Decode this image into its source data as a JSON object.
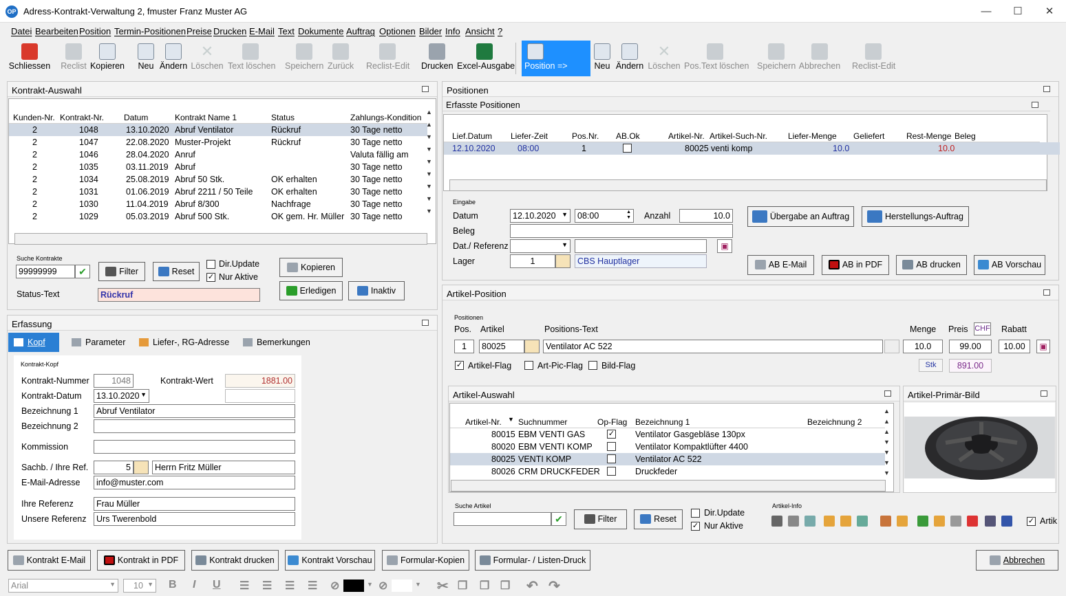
{
  "window": {
    "title": "Adress-Kontrakt-Verwaltung  2,  fmuster   Franz Muster AG",
    "min": "—",
    "max": "☐",
    "close": "✕"
  },
  "menu": [
    "Datei",
    "Bearbeiten",
    "Position",
    "Termin-Positionen",
    "Preise",
    "Drucken",
    "E-Mail",
    "Text",
    "Dokumente",
    "Auftrag",
    "Optionen",
    "Bilder",
    "Info",
    "Ansicht",
    "?"
  ],
  "toolbar_left": [
    "Schliessen",
    "Reclist",
    "Kopieren",
    "Neu",
    "Ändern",
    "Löschen",
    "Text löschen",
    "Speichern",
    "Zurück",
    "Reclist-Edit",
    "Drucken",
    "Excel-Ausgabe"
  ],
  "toolbar_right": [
    "Position =>",
    "Neu",
    "Ändern",
    "Löschen",
    "Pos.Text löschen",
    "Speichern",
    "Abbrechen",
    "Reclist-Edit"
  ],
  "kontrakt": {
    "title": "Kontrakt-Auswahl",
    "headers": [
      "Kunden-Nr.",
      "Kontrakt-Nr.",
      "Datum",
      "Kontrakt Name 1",
      "Status",
      "Zahlungs-Kondition"
    ],
    "rows": [
      [
        "2",
        "1048",
        "13.10.2020",
        "Abruf Ventilator",
        "Rückruf",
        "30 Tage netto"
      ],
      [
        "2",
        "1047",
        "22.08.2020",
        "Muster-Projekt",
        "Rückruf",
        "30 Tage netto"
      ],
      [
        "2",
        "1046",
        "28.04.2020",
        "Anruf",
        "",
        "Valuta fällig am"
      ],
      [
        "2",
        "1035",
        "03.11.2019",
        "Abruf",
        "",
        "30 Tage netto"
      ],
      [
        "2",
        "1034",
        "25.08.2019",
        "Abruf 50 Stk.",
        "OK erhalten",
        "30 Tage netto"
      ],
      [
        "2",
        "1031",
        "01.06.2019",
        "Abruf 2211 / 50 Teile",
        "OK erhalten",
        "30 Tage netto"
      ],
      [
        "2",
        "1030",
        "11.04.2019",
        "Abruf 8/300",
        "Nachfrage",
        "30 Tage netto"
      ],
      [
        "2",
        "1029",
        "05.03.2019",
        "Abruf 500 Stk.",
        "OK gem. Hr. Müller",
        "30 Tage netto"
      ]
    ],
    "search_label": "Suche Kontrakte",
    "search_value": "99999999",
    "filter": "Filter",
    "reset": "Reset",
    "dir_update": "Dir.Update",
    "nur_aktive": "Nur Aktive",
    "kopieren": "Kopieren",
    "erledigen": "Erledigen",
    "inaktiv": "Inaktiv",
    "status_label": "Status-Text",
    "status_value": "Rückruf"
  },
  "erfassung": {
    "title": "Erfassung",
    "tabs": [
      "Kopf",
      "Parameter",
      "Liefer-, RG-Adresse",
      "Bemerkungen"
    ],
    "group": "Kontrakt-Kopf",
    "nummer_l": "Kontrakt-Nummer",
    "nummer": "1048",
    "wert_l": "Kontrakt-Wert",
    "wert": "1881.00",
    "datum_l": "Kontrakt-Datum",
    "datum": "13.10.2020",
    "bez1_l": "Bezeichnung 1",
    "bez1": "Abruf Ventilator",
    "bez2_l": "Bezeichnung 2",
    "kommission_l": "Kommission",
    "sachb_l": "Sachb. / Ihre Ref.",
    "sachb_nr": "5",
    "sachb": "Herrn Fritz Müller",
    "email_l": "E-Mail-Adresse",
    "email": "info@muster.com",
    "ihre_l": "Ihre Referenz",
    "ihre": "Frau Müller",
    "unsere_l": "Unsere Referenz",
    "unsere": "Urs Twerenbold"
  },
  "positionen": {
    "title": "Positionen",
    "sub": "Erfasste Positionen",
    "headers": [
      "Lief.Datum",
      "Liefer-Zeit",
      "Pos.Nr.",
      "AB.Ok",
      "Artikel-Nr.",
      "Artikel-Such-Nr.",
      "Liefer-Menge",
      "Geliefert",
      "Rest-Menge",
      "Beleg"
    ],
    "row": [
      "12.10.2020",
      "08:00",
      "1",
      "",
      "80025",
      "venti komp",
      "10.0",
      "",
      "10.0",
      ""
    ],
    "eingabe": "Eingabe",
    "datum_l": "Datum",
    "datum": "12.10.2020",
    "zeit": "08:00",
    "anzahl_l": "Anzahl",
    "anzahl": "10.0",
    "beleg_l": "Beleg",
    "ref_l": "Dat./ Referenz",
    "lager_l": "Lager",
    "lager_nr": "1",
    "lager": "CBS Hauptlager",
    "uebergabe": "Übergabe an Auftrag",
    "herstellung": "Herstellungs-Auftrag",
    "ab_email": "AB E-Mail",
    "ab_pdf": "AB in PDF",
    "ab_drucken": "AB drucken",
    "ab_vorschau": "AB Vorschau"
  },
  "artpos": {
    "title": "Artikel-Position",
    "group": "Positionen",
    "pos_l": "Pos.",
    "artikel_l": "Artikel",
    "text_l": "Positions-Text",
    "menge_l": "Menge",
    "preis_l": "Preis",
    "chf": "CHF",
    "rabatt_l": "Rabatt",
    "pos": "1",
    "artikel": "80025",
    "text": "Ventilator AC 522",
    "menge": "10.0",
    "preis": "99.00",
    "rabatt": "10.00",
    "stk": "Stk",
    "total": "891.00",
    "artikel_flag": "Artikel-Flag",
    "artpic_flag": "Art-Pic-Flag",
    "bild_flag": "Bild-Flag"
  },
  "artauswahl": {
    "title": "Artikel-Auswahl",
    "headers": [
      "Artikel-Nr.",
      "Suchnummer",
      "Op-Flag",
      "Bezeichnung 1",
      "Bezeichnung 2"
    ],
    "rows": [
      [
        "80015",
        "EBM VENTI GAS",
        "✓",
        "Ventilator Gasgebläse 130px",
        ""
      ],
      [
        "80020",
        "EBM VENTI KOMP",
        "",
        "Ventilator Kompaktlüfter 4400",
        ""
      ],
      [
        "80025",
        "VENTI KOMP",
        "",
        "Ventilator AC 522",
        ""
      ],
      [
        "80026",
        "CRM DRUCKFEDER",
        "",
        "Druckfeder",
        ""
      ]
    ],
    "search_label": "Suche Artikel",
    "filter": "Filter",
    "reset": "Reset",
    "dir_update": "Dir.Update",
    "nur_aktive": "Nur Aktive",
    "info": "Artikel-Info",
    "artik": "Artik"
  },
  "bild": {
    "title": "Artikel-Primär-Bild"
  },
  "bottom": [
    "Kontrakt E-Mail",
    "Kontrakt in PDF",
    "Kontrakt drucken",
    "Kontrakt Vorschau",
    "Formular-Kopien",
    "Formular- / Listen-Druck"
  ],
  "abbrechen": "Abbrechen",
  "format": {
    "font": "Arial",
    "size": "10"
  }
}
